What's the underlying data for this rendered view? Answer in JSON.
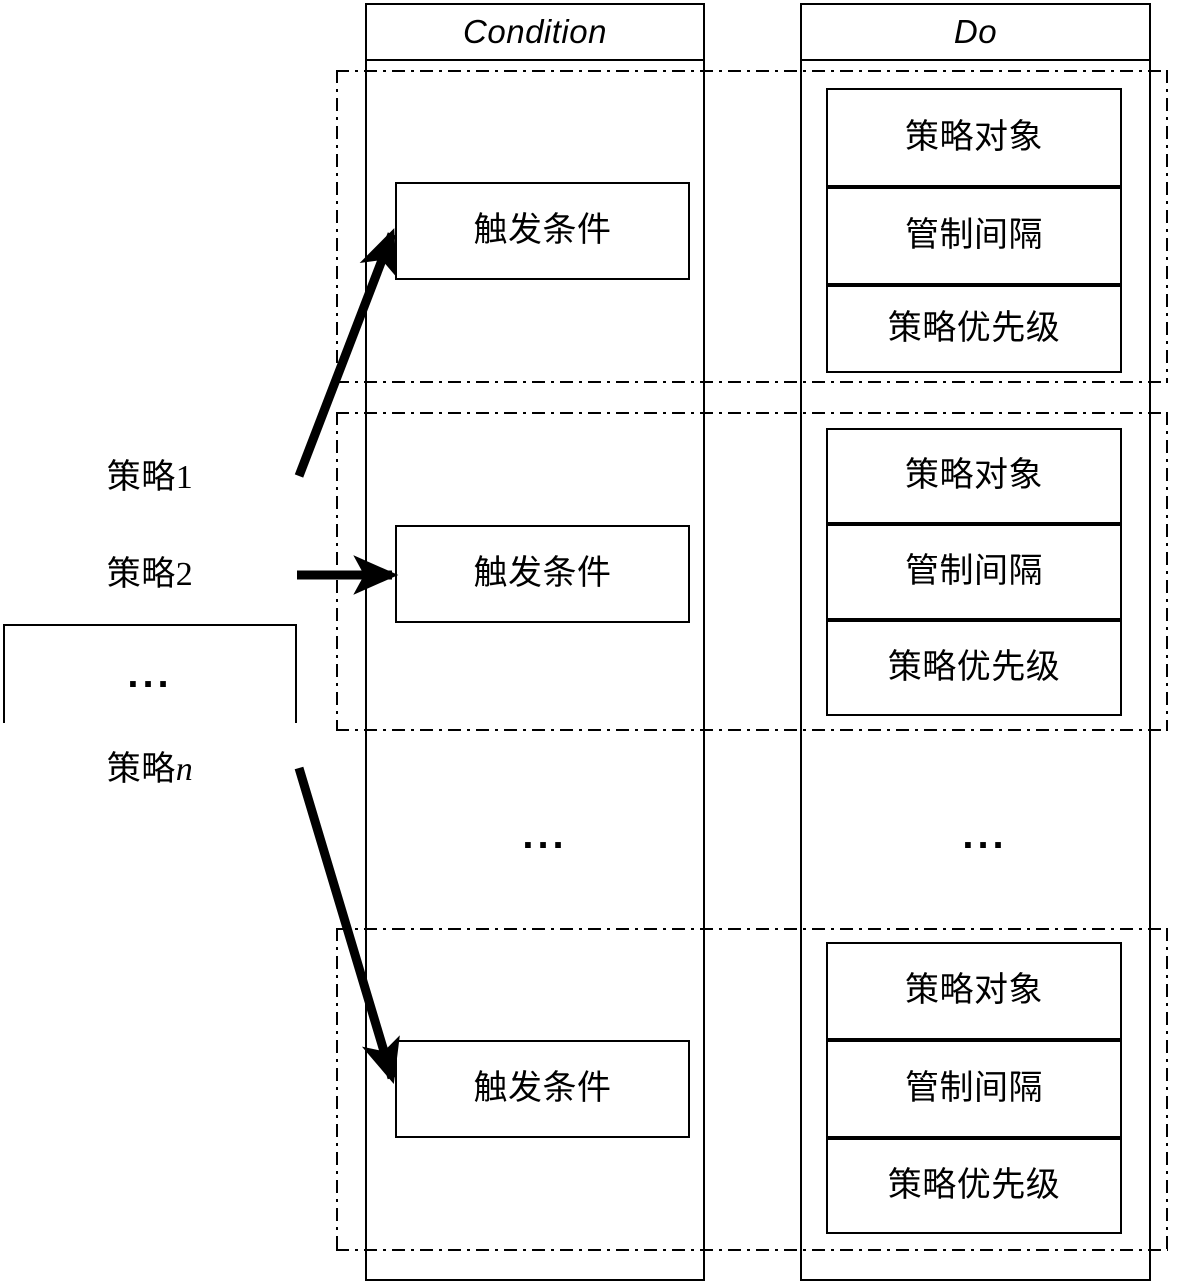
{
  "diagram": {
    "title": "Policy condition-action (Condition / Do) structure diagram",
    "colors": {
      "stroke": "#000000",
      "background": "#ffffff"
    },
    "columns": [
      {
        "key": "condition",
        "label": "Condition"
      },
      {
        "key": "do",
        "label": "Do"
      }
    ],
    "policy_list": {
      "name": "policy-list",
      "items": [
        {
          "text": "策略1",
          "base": "策略",
          "suffix": "1",
          "italic_suffix": false
        },
        {
          "text": "策略2",
          "base": "策略",
          "suffix": "2",
          "italic_suffix": false
        },
        {
          "text": "...",
          "base": "",
          "suffix": "",
          "italic_suffix": false
        },
        {
          "text": "策略n",
          "base": "策略",
          "suffix": "n",
          "italic_suffix": true
        }
      ]
    },
    "groups": [
      {
        "name": "rule-group-1",
        "condition": {
          "label": "触发条件"
        },
        "do": {
          "rows": [
            "策略对象",
            "管制间隔",
            "策略优先级"
          ]
        }
      },
      {
        "name": "rule-group-2",
        "condition": {
          "label": "触发条件"
        },
        "do": {
          "rows": [
            "策略对象",
            "管制间隔",
            "策略优先级"
          ]
        }
      },
      {
        "name": "rule-group-3",
        "condition": {
          "label": "触发条件"
        },
        "do": {
          "rows": [
            "策略对象",
            "管制间隔",
            "策略优先级"
          ]
        }
      }
    ],
    "middle_ellipsis": {
      "condition": "...",
      "do": "..."
    },
    "arrows": [
      {
        "name": "arrow-policy1-to-condition1",
        "from": "策略1",
        "to": "触发条件"
      },
      {
        "name": "arrow-policy2-to-condition2",
        "from": "策略2",
        "to": "触发条件"
      },
      {
        "name": "arrow-policyn-to-condition3",
        "from": "策略n",
        "to": "触发条件"
      }
    ]
  }
}
